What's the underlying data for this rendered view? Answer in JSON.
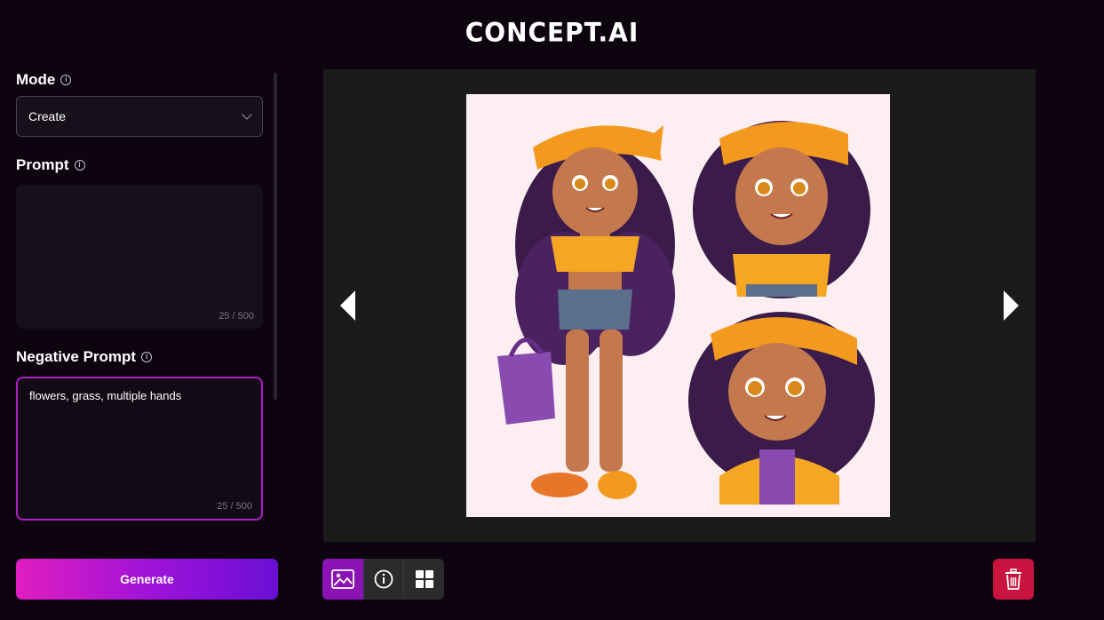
{
  "app": {
    "logo": "CONCEPT.AI"
  },
  "sidebar": {
    "mode": {
      "label": "Mode",
      "value": "Create"
    },
    "prompt": {
      "label": "Prompt",
      "value": "",
      "counter": "25 / 500"
    },
    "negative_prompt": {
      "label": "Negative Prompt",
      "value": "flowers, grass, multiple hands",
      "counter": "25 / 500"
    },
    "generate_label": "Generate"
  },
  "toolbar": {
    "tools": [
      {
        "icon": "image-icon",
        "active": true
      },
      {
        "icon": "info-icon",
        "active": false
      },
      {
        "icon": "grid-icon",
        "active": false
      }
    ],
    "delete_icon": "trash-icon"
  },
  "colors": {
    "accent": "#b01cc8",
    "generate_gradient": [
      "#e01ec0",
      "#6a0fd6"
    ],
    "delete": "#c8143f",
    "background": "#0d0410"
  }
}
